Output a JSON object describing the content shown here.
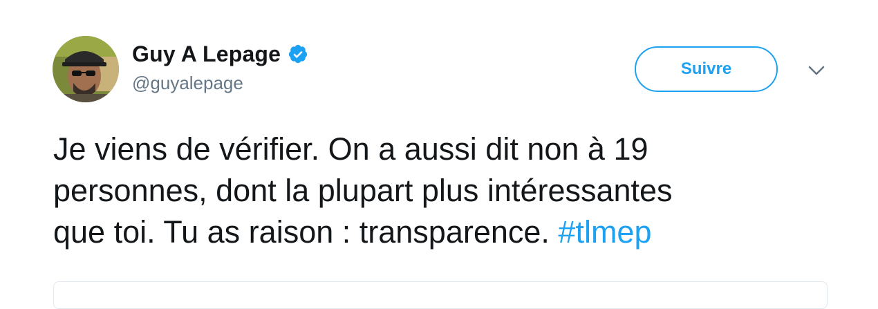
{
  "user": {
    "display_name": "Guy A Lepage",
    "handle": "@guyalepage",
    "verified": true,
    "avatar_icon": "profile-photo"
  },
  "actions": {
    "follow_label": "Suivre",
    "menu_icon": "chevron-down-icon"
  },
  "tweet": {
    "lines": [
      "Je viens de vérifier. On a aussi dit non à 19",
      "personnes, dont la plupart plus intéressantes",
      "que toi. Tu as raison : transparence. "
    ],
    "hashtag": "#tlmep"
  },
  "colors": {
    "accent": "#1da1f2",
    "text": "#14171a",
    "secondary_text": "#657786",
    "border": "#e1e8ed"
  }
}
